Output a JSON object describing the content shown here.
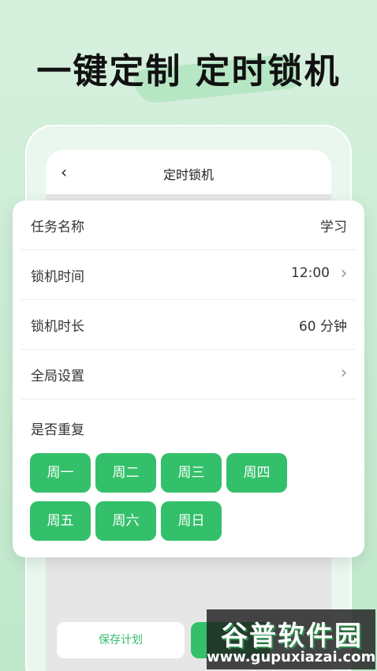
{
  "headline": "一键定制 定时锁机",
  "phone": {
    "title": "定时锁机",
    "back_icon": "chevron-left-icon",
    "save_button": "保存计划"
  },
  "form": {
    "task_name": {
      "label": "任务名称",
      "value": "学习"
    },
    "lock_time": {
      "label": "锁机时间",
      "value": "12:00"
    },
    "lock_duration": {
      "label": "锁机时长",
      "value": "60 分钟"
    },
    "global_settings": {
      "label": "全局设置"
    },
    "repeat": {
      "label": "是否重复",
      "days": [
        "周一",
        "周二",
        "周三",
        "周四",
        "周五",
        "周六",
        "周日"
      ]
    }
  },
  "watermark": {
    "brand": "谷普软件园",
    "url": "www.gupuxiazai.com"
  },
  "colors": {
    "accent": "#34c06a",
    "background": "#c9ecd3"
  }
}
